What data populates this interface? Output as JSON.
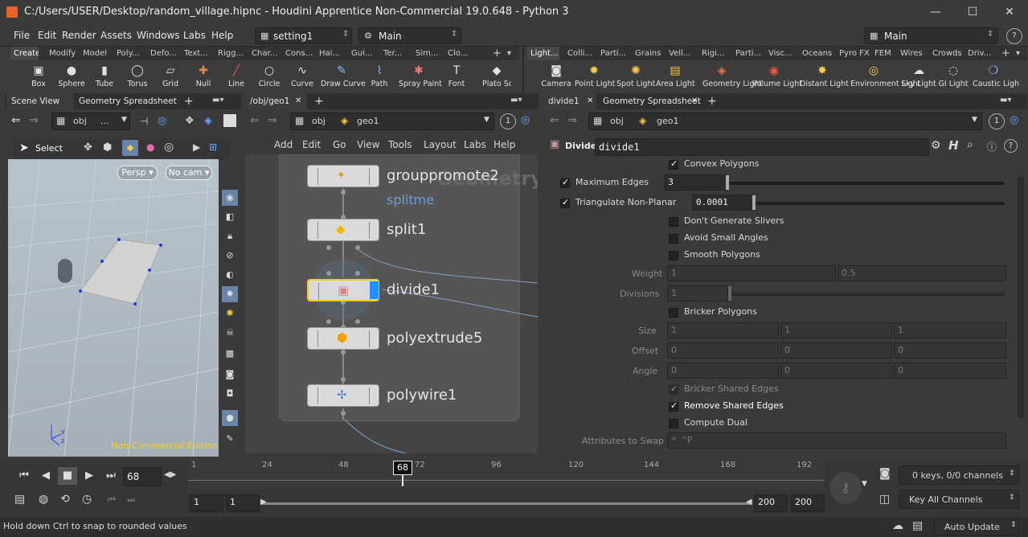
{
  "titlebar": {
    "title": "C:/Users/USER/Desktop/random_village.hipnc - Houdini Apprentice Non-Commercial 19.0.648 - Python 3",
    "minimize": "—",
    "maximize": "☐",
    "close": "✕"
  },
  "menubar": {
    "items": [
      "File",
      "Edit",
      "Render",
      "Assets",
      "Windows",
      "Labs",
      "Help"
    ],
    "desktop": "setting1",
    "context": "Main",
    "right_desktop": "Main",
    "help": "?"
  },
  "shelf_left": {
    "tabs": [
      "Create",
      "Modify",
      "Model",
      "Poly...",
      "Defo...",
      "Text...",
      "Rigg...",
      "Char...",
      "Cons...",
      "Hai...",
      "Gui...",
      "Ter...",
      "Sim...",
      "Clo..."
    ],
    "tools": [
      {
        "label": "Box",
        "icon": "▣"
      },
      {
        "label": "Sphere",
        "icon": "●"
      },
      {
        "label": "Tube",
        "icon": "▮"
      },
      {
        "label": "Torus",
        "icon": "◯"
      },
      {
        "label": "Grid",
        "icon": "▱"
      },
      {
        "label": "Null",
        "icon": "✚"
      },
      {
        "label": "Line",
        "icon": "╱"
      },
      {
        "label": "Circle",
        "icon": "○"
      },
      {
        "label": "Curve",
        "icon": "∿"
      },
      {
        "label": "Draw Curve",
        "icon": "✎"
      },
      {
        "label": "Path",
        "icon": "⌇"
      },
      {
        "label": "Spray Paint",
        "icon": "✱"
      },
      {
        "label": "Font",
        "icon": "T"
      },
      {
        "label": "Plato Soli",
        "icon": "◆"
      }
    ]
  },
  "shelf_right": {
    "tabs": [
      "Light...",
      "Colli...",
      "Parti...",
      "Grains",
      "Vell...",
      "Rigi...",
      "Parti...",
      "Visc...",
      "Oceans",
      "Pyro FX",
      "FEM",
      "Wires",
      "Crowds",
      "Driv..."
    ],
    "tools": [
      {
        "label": "Camera",
        "icon": "◙"
      },
      {
        "label": "Point Light",
        "icon": "✹"
      },
      {
        "label": "Spot Light",
        "icon": "✺"
      },
      {
        "label": "Area Light",
        "icon": "▤"
      },
      {
        "label": "Geometry Light",
        "icon": "◈"
      },
      {
        "label": "Volume Light",
        "icon": "◉"
      },
      {
        "label": "Distant Light",
        "icon": "✸"
      },
      {
        "label": "Environment Light",
        "icon": "◎"
      },
      {
        "label": "Sky Light",
        "icon": "☁"
      },
      {
        "label": "GI Light",
        "icon": "◌"
      },
      {
        "label": "Caustic Ligh",
        "icon": "❍"
      }
    ]
  },
  "scene_pane": {
    "tabs": [
      "Scene View",
      "Geometry Spreadsheet"
    ],
    "path": "obj",
    "path2": "...",
    "select_label": "Select",
    "persp": "Persp ▾",
    "cam": "No cam ▾",
    "watermark": "Non-Commercial Edition",
    "axes": {
      "x": "x",
      "y": "y",
      "z": "z"
    }
  },
  "network_pane": {
    "tabs": [
      "/obj/geo1"
    ],
    "path": "obj",
    "node": "geo1",
    "one": "1",
    "menu": [
      "Add",
      "Edit",
      "Go",
      "View",
      "Tools",
      "Layout",
      "Labs",
      "Help"
    ],
    "watermark": "Geometry",
    "group_label": "splitme",
    "nodes": [
      "grouppromote2",
      "split1",
      "divide1",
      "polyextrude5",
      "polywire1"
    ]
  },
  "param_pane": {
    "tabs": [
      "divide1",
      "Geometry Spreadsheet"
    ],
    "path": "obj",
    "node": "geo1",
    "one": "1",
    "type": "Divide",
    "name": "divide1",
    "convex": "Convex Polygons",
    "max_edges_label": "Maximum Edges",
    "max_edges": "3",
    "triangulate_label": "Triangulate Non-Planar",
    "triangulate": "0.0001",
    "no_slivers": "Don't Generate Slivers",
    "avoid_small": "Avoid Small Angles",
    "smooth": "Smooth Polygons",
    "weight_label": "Weight",
    "weight": [
      "1",
      "0.5"
    ],
    "divisions_label": "Divisions",
    "divisions": "1",
    "bricker": "Bricker Polygons",
    "size_label": "Size",
    "size": [
      "1",
      "1",
      "1"
    ],
    "offset_label": "Offset",
    "offset": [
      "0",
      "0",
      "0"
    ],
    "angle_label": "Angle",
    "angle": [
      "0",
      "0",
      "0"
    ],
    "bricker_shared": "Bricker Shared Edges",
    "remove_shared": "Remove Shared Edges",
    "compute_dual": "Compute Dual",
    "attrs_label": "Attributes to Swap",
    "attrs": "* ^P"
  },
  "timeline": {
    "frame": "68",
    "marker": "68",
    "ticks": [
      "1",
      "24",
      "48",
      "72",
      "96",
      "120",
      "144",
      "168",
      "192"
    ],
    "start": "1",
    "start2": "1",
    "end": "200",
    "end2": "200",
    "keys": "0 keys, 0/0 channels",
    "key_all": "Key All Channels"
  },
  "statusbar": {
    "message": "Hold down Ctrl to snap to rounded values",
    "auto_update": "Auto Update"
  }
}
